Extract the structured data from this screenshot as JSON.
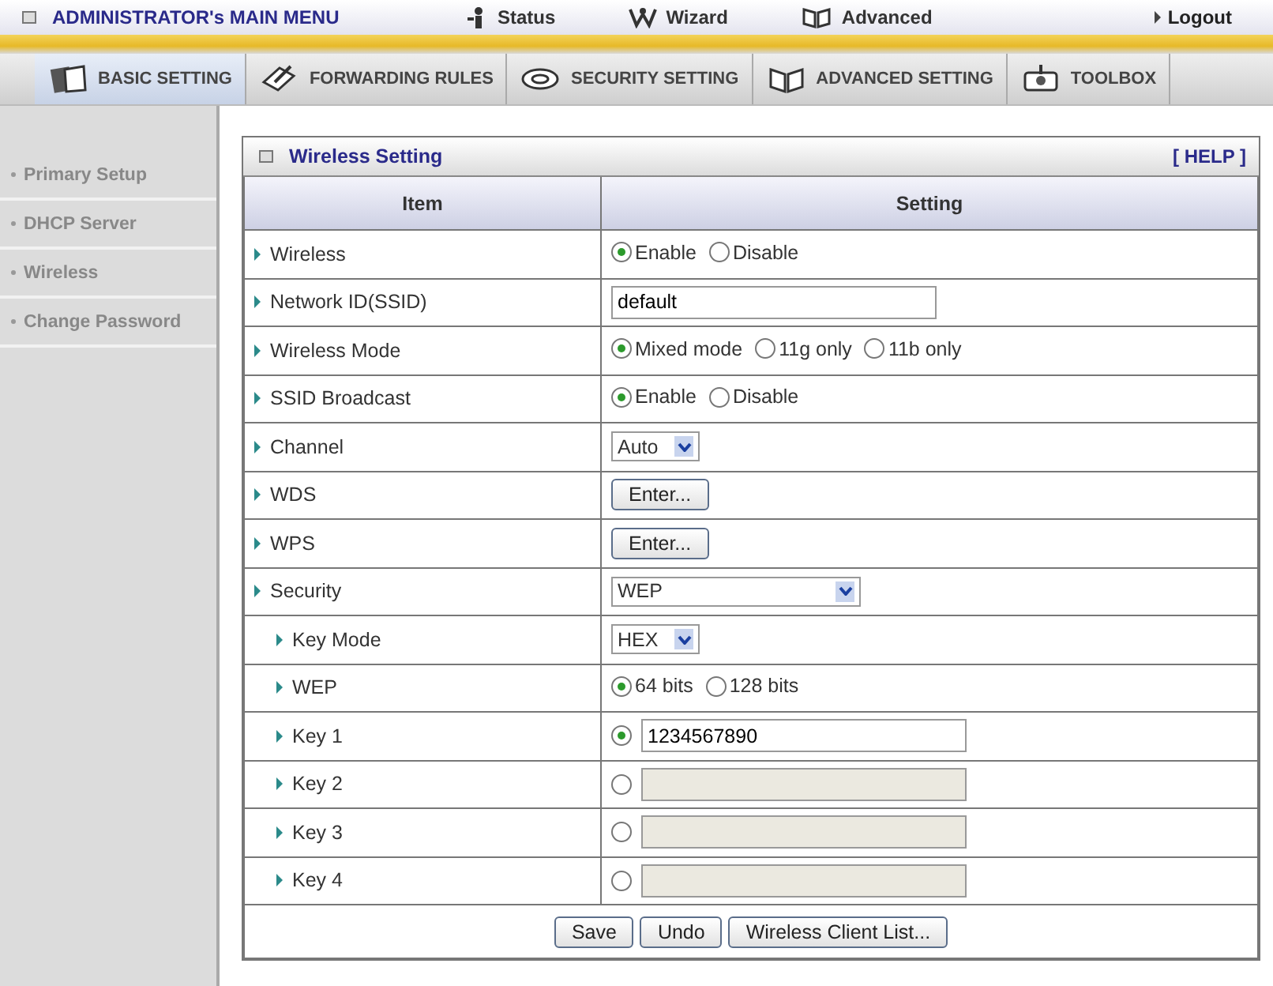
{
  "top_menu": {
    "title": "ADMINISTRATOR's MAIN MENU",
    "items": [
      {
        "label": "Status"
      },
      {
        "label": "Wizard"
      },
      {
        "label": "Advanced"
      }
    ],
    "logout": "Logout"
  },
  "tabs": [
    {
      "label": "BASIC SETTING",
      "selected": true
    },
    {
      "label": "FORWARDING RULES",
      "selected": false
    },
    {
      "label": "SECURITY SETTING",
      "selected": false
    },
    {
      "label": "ADVANCED SETTING",
      "selected": false
    },
    {
      "label": "TOOLBOX",
      "selected": false
    }
  ],
  "sidebar": {
    "items": [
      {
        "label": "Primary Setup"
      },
      {
        "label": "DHCP Server"
      },
      {
        "label": "Wireless"
      },
      {
        "label": "Change Password"
      }
    ]
  },
  "panel": {
    "title": "Wireless Setting",
    "help": "[ HELP ]",
    "columns": [
      "Item",
      "Setting"
    ],
    "rows": [
      {
        "label": "Wireless",
        "kind": "radio",
        "options": [
          {
            "label": "Enable",
            "selected": true
          },
          {
            "label": "Disable",
            "selected": false
          }
        ]
      },
      {
        "label": "Network ID(SSID)",
        "kind": "text",
        "value": "default"
      },
      {
        "label": "Wireless Mode",
        "kind": "radio",
        "options": [
          {
            "label": "Mixed mode",
            "selected": true
          },
          {
            "label": "11g only",
            "selected": false
          },
          {
            "label": "11b only",
            "selected": false
          }
        ]
      },
      {
        "label": "SSID Broadcast",
        "kind": "radio",
        "options": [
          {
            "label": "Enable",
            "selected": true
          },
          {
            "label": "Disable",
            "selected": false
          }
        ]
      },
      {
        "label": "Channel",
        "kind": "select",
        "value": "Auto"
      },
      {
        "label": "WDS",
        "kind": "button",
        "value": "Enter..."
      },
      {
        "label": "WPS",
        "kind": "button",
        "value": "Enter..."
      },
      {
        "label": "Security",
        "kind": "select",
        "value": "WEP",
        "children": [
          {
            "label": "Key Mode",
            "kind": "select",
            "value": "HEX"
          },
          {
            "label": "WEP",
            "kind": "radio",
            "options": [
              {
                "label": "64 bits",
                "selected": true
              },
              {
                "label": "128 bits",
                "selected": false
              }
            ]
          },
          {
            "label": "Key 1",
            "kind": "key",
            "selected": true,
            "value": "1234567890",
            "disabled": false
          },
          {
            "label": "Key 2",
            "kind": "key",
            "selected": false,
            "disabled": true
          },
          {
            "label": "Key 3",
            "kind": "key",
            "selected": false,
            "disabled": true
          },
          {
            "label": "Key 4",
            "kind": "key",
            "selected": false,
            "disabled": true
          }
        ]
      }
    ],
    "buttons": [
      "Save",
      "Undo",
      "Wireless Client List..."
    ]
  }
}
